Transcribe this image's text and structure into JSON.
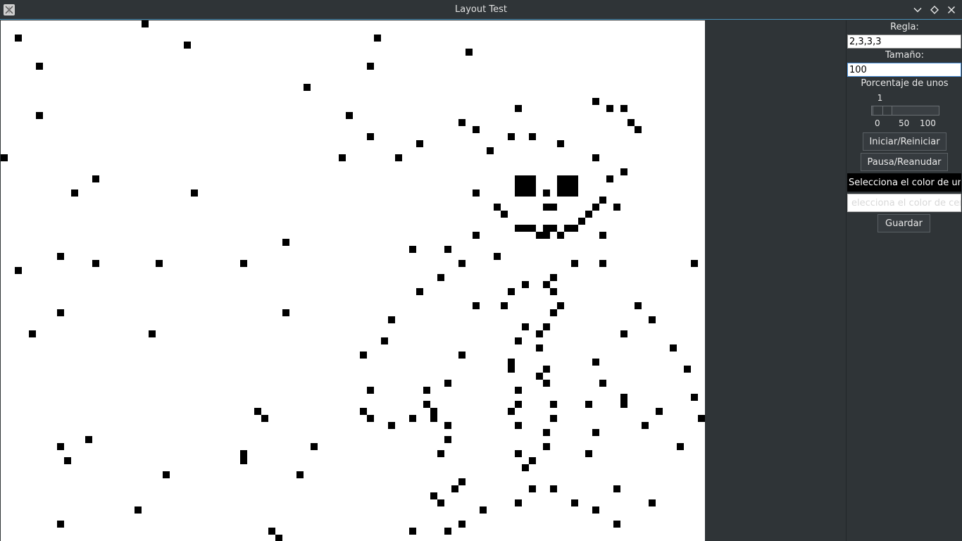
{
  "window": {
    "title": "Layout Test",
    "controls": [
      "chevron-down-icon",
      "diamond-icon",
      "close-icon"
    ]
  },
  "panel": {
    "rule_label": "Regla:",
    "rule_value": "2,3,3,3",
    "size_label": "Tamaño:",
    "size_value": "100",
    "percent_label": "Porcentaje de unos",
    "percent_value": "1",
    "slider_min": "0",
    "slider_mid": "50",
    "slider_max": "100",
    "start_button": "Iniciar/Reiniciar",
    "pause_button": "Pausa/Reanudar",
    "ones_color_button": "Selecciona el color de unos",
    "zeros_color_button": "elecciona el color de cero",
    "save_button": "Guardar"
  },
  "colors": {
    "live_cell": "#000000",
    "dead_cell": "#ffffff",
    "ones_button_bg": "#000000",
    "zeros_button_bg": "#ffffff"
  },
  "grid": {
    "size": 100,
    "live_cells": [
      [
        20,
        0
      ],
      [
        53,
        2
      ],
      [
        2,
        2
      ],
      [
        26,
        3
      ],
      [
        66,
        4
      ],
      [
        5,
        6
      ],
      [
        52,
        6
      ],
      [
        43,
        9
      ],
      [
        84,
        11
      ],
      [
        73,
        12
      ],
      [
        86,
        12
      ],
      [
        88,
        12
      ],
      [
        5,
        13
      ],
      [
        49,
        13
      ],
      [
        65,
        14
      ],
      [
        89,
        14
      ],
      [
        67,
        15
      ],
      [
        90,
        15
      ],
      [
        52,
        16
      ],
      [
        72,
        16
      ],
      [
        75,
        16
      ],
      [
        59,
        17
      ],
      [
        79,
        17
      ],
      [
        69,
        18
      ],
      [
        0,
        19
      ],
      [
        48,
        19
      ],
      [
        56,
        19
      ],
      [
        84,
        19
      ],
      [
        88,
        21
      ],
      [
        13,
        22
      ],
      [
        86,
        22
      ],
      [
        10,
        24
      ],
      [
        27,
        24
      ],
      [
        67,
        24
      ],
      [
        77,
        24
      ],
      [
        85,
        25
      ],
      [
        70,
        26
      ],
      [
        77,
        26
      ],
      [
        78,
        26
      ],
      [
        84,
        26
      ],
      [
        87,
        26
      ],
      [
        71,
        27
      ],
      [
        83,
        27
      ],
      [
        82,
        28
      ],
      [
        73,
        29
      ],
      [
        74,
        29
      ],
      [
        75,
        29
      ],
      [
        77,
        29
      ],
      [
        78,
        29
      ],
      [
        80,
        29
      ],
      [
        81,
        29
      ],
      [
        76,
        30
      ],
      [
        77,
        30
      ],
      [
        79,
        30
      ],
      [
        67,
        30
      ],
      [
        85,
        30
      ],
      [
        40,
        31
      ],
      [
        58,
        32
      ],
      [
        63,
        32
      ],
      [
        8,
        33
      ],
      [
        70,
        33
      ],
      [
        13,
        34
      ],
      [
        22,
        34
      ],
      [
        34,
        34
      ],
      [
        65,
        34
      ],
      [
        81,
        34
      ],
      [
        85,
        34
      ],
      [
        98,
        34
      ],
      [
        2,
        35
      ],
      [
        78,
        36
      ],
      [
        62,
        36
      ],
      [
        74,
        37
      ],
      [
        77,
        37
      ],
      [
        59,
        38
      ],
      [
        72,
        38
      ],
      [
        78,
        38
      ],
      [
        67,
        40
      ],
      [
        71,
        40
      ],
      [
        79,
        40
      ],
      [
        90,
        40
      ],
      [
        8,
        41
      ],
      [
        40,
        41
      ],
      [
        78,
        41
      ],
      [
        55,
        42
      ],
      [
        92,
        42
      ],
      [
        74,
        43
      ],
      [
        77,
        43
      ],
      [
        4,
        44
      ],
      [
        21,
        44
      ],
      [
        76,
        44
      ],
      [
        88,
        44
      ],
      [
        54,
        45
      ],
      [
        73,
        45
      ],
      [
        76,
        46
      ],
      [
        95,
        46
      ],
      [
        51,
        47
      ],
      [
        65,
        47
      ],
      [
        72,
        48
      ],
      [
        84,
        48
      ],
      [
        97,
        49
      ],
      [
        72,
        49
      ],
      [
        77,
        49
      ],
      [
        76,
        50
      ],
      [
        63,
        51
      ],
      [
        77,
        51
      ],
      [
        85,
        51
      ],
      [
        52,
        52
      ],
      [
        60,
        52
      ],
      [
        73,
        52
      ],
      [
        88,
        53
      ],
      [
        98,
        53
      ],
      [
        60,
        54
      ],
      [
        73,
        54
      ],
      [
        78,
        54
      ],
      [
        83,
        54
      ],
      [
        88,
        54
      ],
      [
        36,
        55
      ],
      [
        51,
        55
      ],
      [
        61,
        55
      ],
      [
        72,
        55
      ],
      [
        93,
        55
      ],
      [
        37,
        56
      ],
      [
        52,
        56
      ],
      [
        58,
        56
      ],
      [
        61,
        56
      ],
      [
        78,
        56
      ],
      [
        99,
        56
      ],
      [
        55,
        57
      ],
      [
        63,
        57
      ],
      [
        73,
        57
      ],
      [
        91,
        57
      ],
      [
        77,
        58
      ],
      [
        84,
        58
      ],
      [
        63,
        59
      ],
      [
        12,
        59
      ],
      [
        8,
        60
      ],
      [
        44,
        60
      ],
      [
        77,
        60
      ],
      [
        96,
        60
      ],
      [
        34,
        61
      ],
      [
        62,
        61
      ],
      [
        73,
        61
      ],
      [
        83,
        61
      ],
      [
        9,
        62
      ],
      [
        34,
        62
      ],
      [
        75,
        62
      ],
      [
        74,
        63
      ],
      [
        23,
        64
      ],
      [
        42,
        64
      ],
      [
        65,
        65
      ],
      [
        64,
        66
      ],
      [
        75,
        66
      ],
      [
        78,
        66
      ],
      [
        87,
        66
      ],
      [
        61,
        67
      ],
      [
        62,
        68
      ],
      [
        73,
        68
      ],
      [
        81,
        68
      ],
      [
        92,
        68
      ],
      [
        19,
        69
      ],
      [
        68,
        69
      ],
      [
        84,
        69
      ],
      [
        8,
        71
      ],
      [
        65,
        71
      ],
      [
        87,
        71
      ],
      [
        38,
        72
      ],
      [
        58,
        72
      ],
      [
        63,
        72
      ],
      [
        39,
        73
      ]
    ],
    "big_blocks": [
      [
        73,
        22,
        3
      ],
      [
        79,
        22,
        3
      ]
    ]
  }
}
